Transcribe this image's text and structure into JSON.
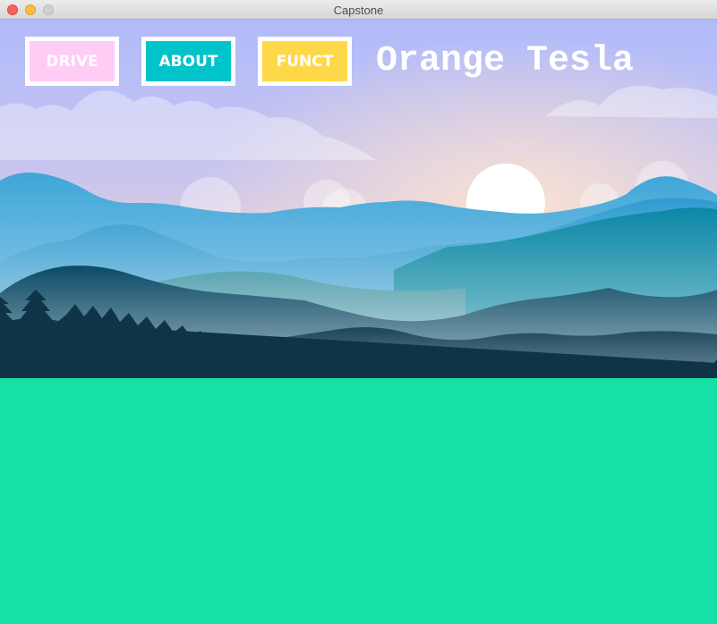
{
  "window": {
    "title": "Capstone"
  },
  "nav": {
    "drive_label": "DRIVE",
    "about_label": "ABOUT",
    "funct_label": "FUNCT"
  },
  "app": {
    "title": "Orange Tesla"
  },
  "colors": {
    "drive_button": "#ffccf5",
    "about_button": "#00c4c9",
    "funct_button": "#ffd84a",
    "ground": "#17e0a6",
    "sky_top": "#b3bdf8",
    "sky_horizon": "#f6d6cb",
    "forest": "#0f3447"
  },
  "icons": {
    "close": "close-icon",
    "minimize": "minimize-icon",
    "maximize": "maximize-icon"
  }
}
